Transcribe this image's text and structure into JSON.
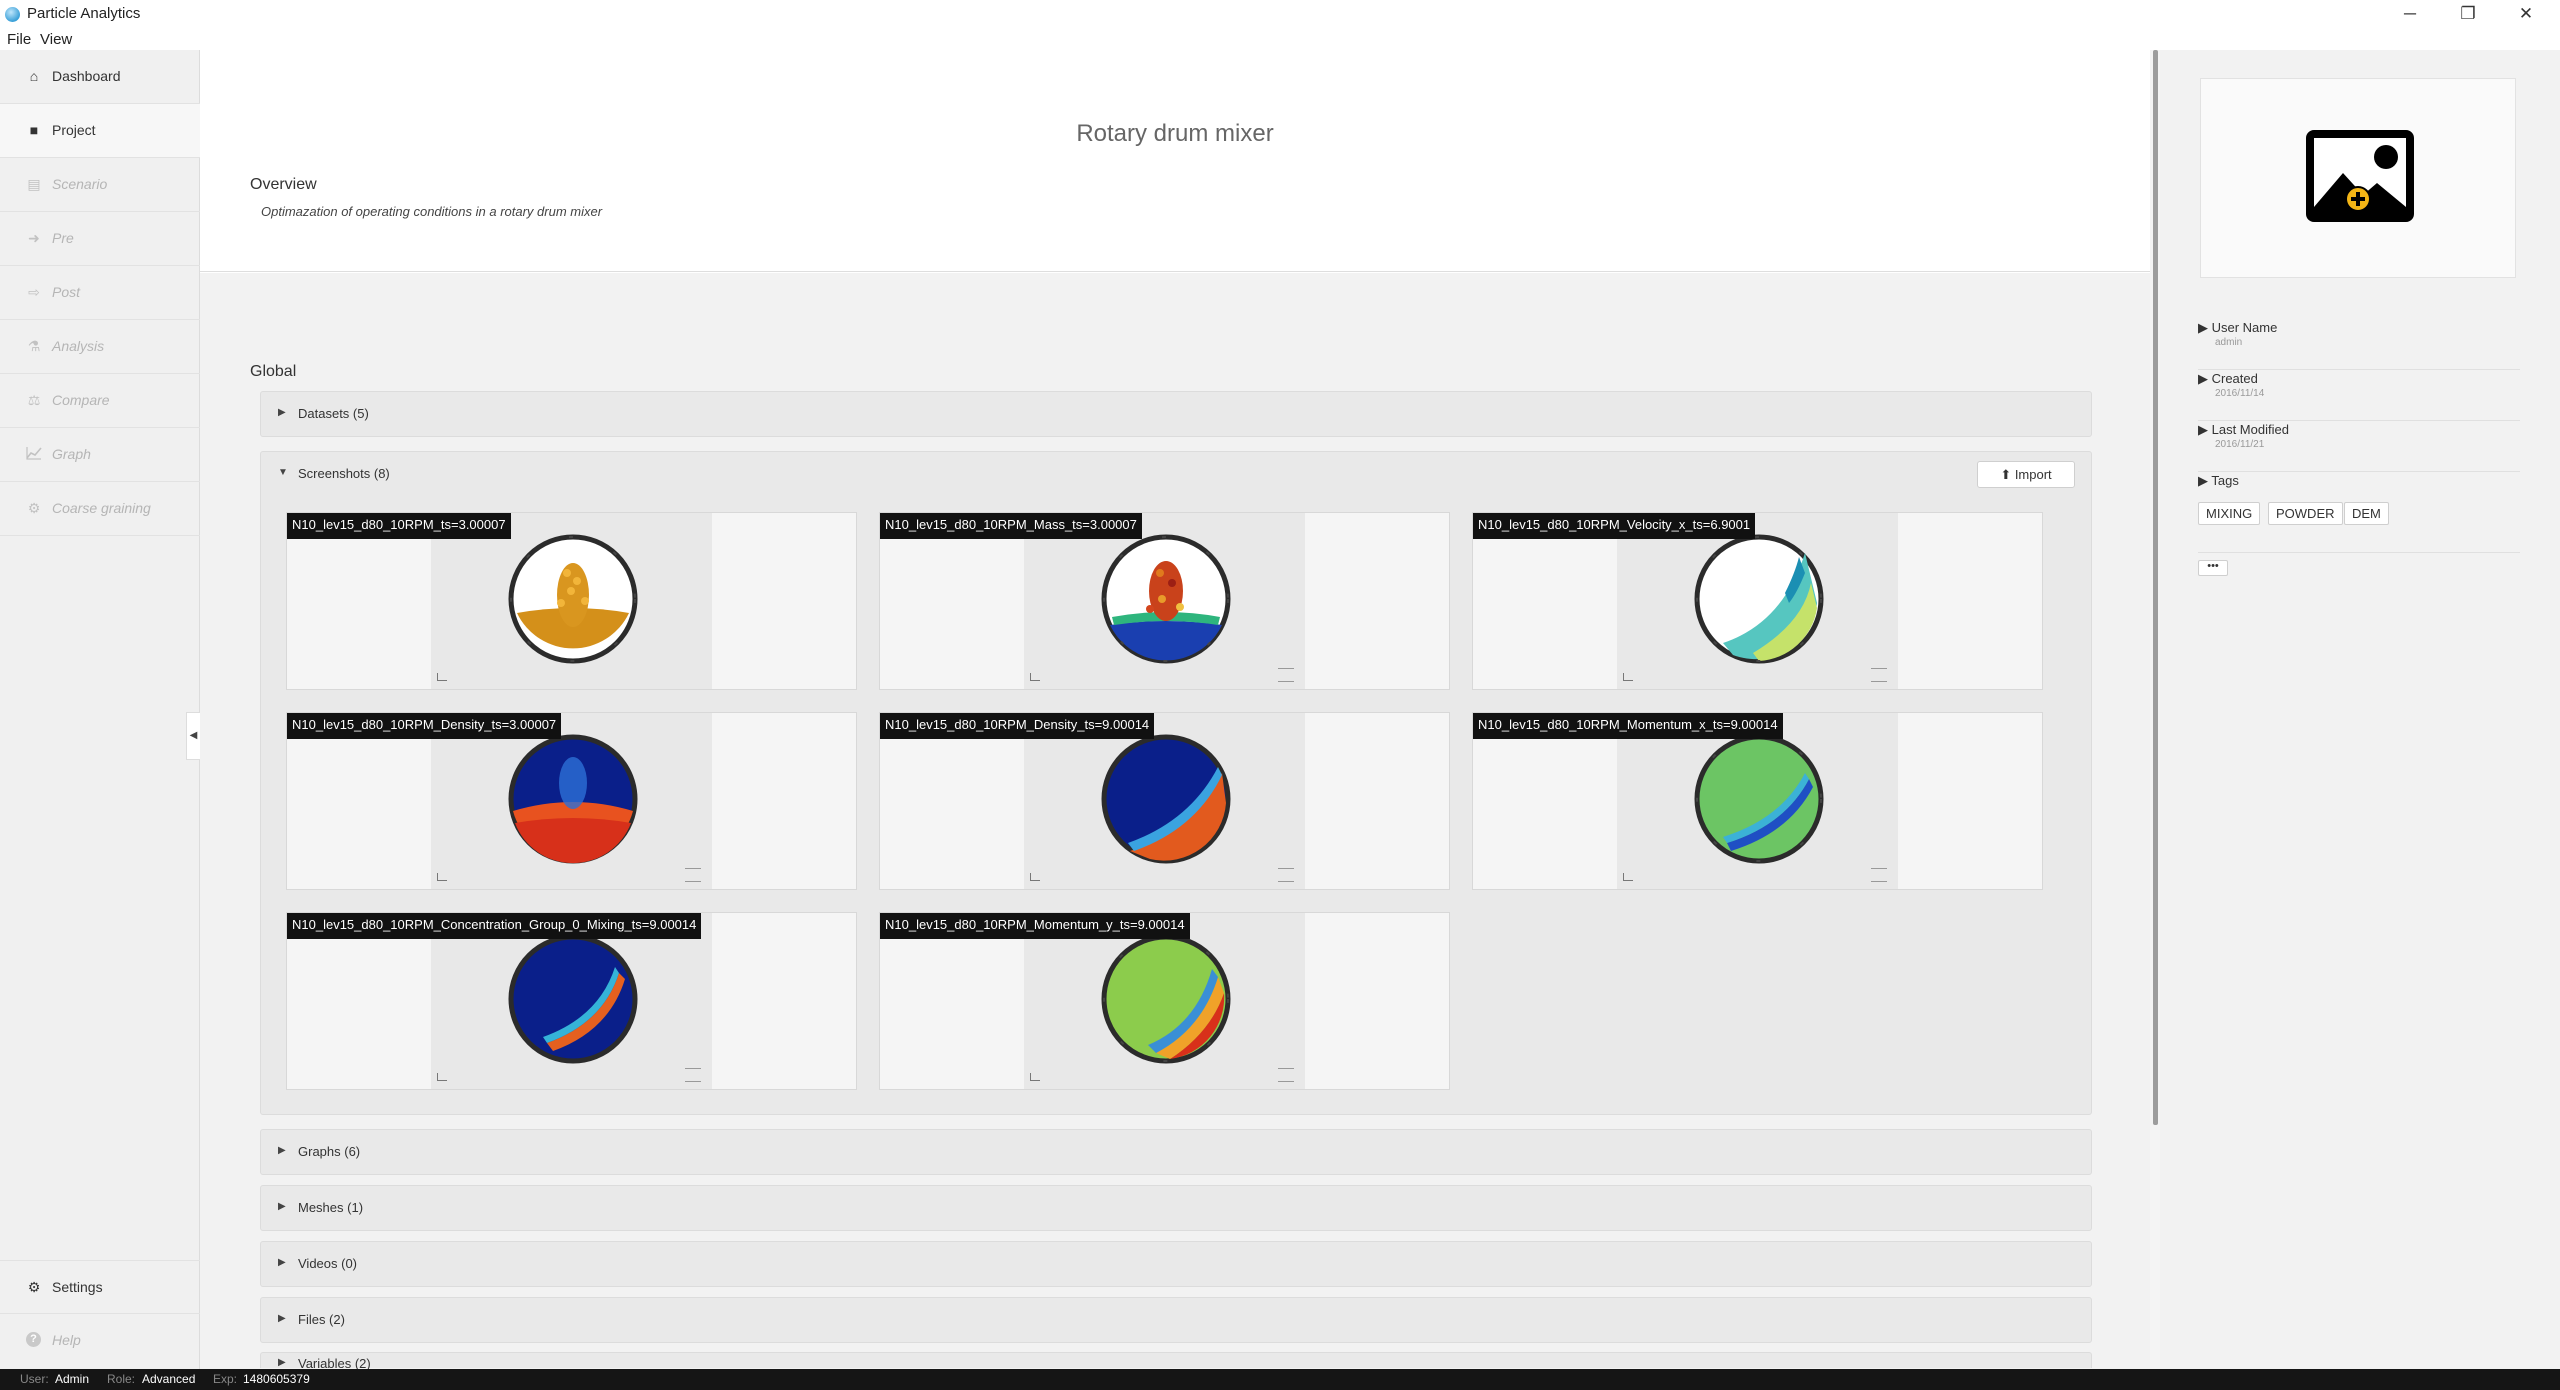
{
  "app": {
    "title": "Particle Analytics"
  },
  "menu": {
    "file": "File",
    "view": "View"
  },
  "window_controls": {
    "minimize": "─",
    "restore": "❐",
    "close": "✕"
  },
  "sidebar": {
    "items": [
      {
        "label": "Dashboard",
        "icon": "home-icon",
        "glyph": "⌂"
      },
      {
        "label": "Project",
        "icon": "folder-icon",
        "glyph": "■"
      },
      {
        "label": "Scenario",
        "icon": "document-icon",
        "glyph": "▤"
      },
      {
        "label": "Pre",
        "icon": "sign-in-icon",
        "glyph": "➜"
      },
      {
        "label": "Post",
        "icon": "sign-out-icon",
        "glyph": "⇨"
      },
      {
        "label": "Analysis",
        "icon": "flask-icon",
        "glyph": "⚗"
      },
      {
        "label": "Compare",
        "icon": "balance-icon",
        "glyph": "⚖"
      },
      {
        "label": "Graph",
        "icon": "line-chart-icon",
        "glyph": "📈"
      },
      {
        "label": "Coarse graining",
        "icon": "gear-icon",
        "glyph": "⚙"
      }
    ],
    "settings": {
      "label": "Settings",
      "icon": "cogs-icon",
      "glyph": "⚙"
    },
    "help": {
      "label": "Help",
      "icon": "help-icon",
      "glyph": "?"
    },
    "collapse_glyph": "◀"
  },
  "main": {
    "title": "Rotary drum mixer",
    "overview_label": "Overview",
    "overview_description": "Optimazation of operating conditions in a rotary drum mixer",
    "global_label": "Global",
    "sections": {
      "datasets": "Datasets (5)",
      "screenshots": "Screenshots (8)",
      "graphs": "Graphs (6)",
      "meshes": "Meshes (1)",
      "videos": "Videos (0)",
      "files": "Files (2)",
      "variables": "Variables (2)"
    },
    "import_label": "⬆ Import",
    "screenshots": [
      "N10_lev15_d80_10RPM_ts=3.00007",
      "N10_lev15_d80_10RPM_Mass_ts=3.00007",
      "N10_lev15_d80_10RPM_Velocity_x_ts=6.9001",
      "N10_lev15_d80_10RPM_Density_ts=3.00007",
      "N10_lev15_d80_10RPM_Density_ts=9.00014",
      "N10_lev15_d80_10RPM_Momentum_x_ts=9.00014",
      "N10_lev15_d80_10RPM_Concentration_Group_0_Mixing_ts=9.00014",
      "N10_lev15_d80_10RPM_Momentum_y_ts=9.00014"
    ]
  },
  "details": {
    "user_name_label": "▶ User Name",
    "user_name": "admin",
    "created_label": "▶ Created",
    "created": "2016/11/14",
    "modified_label": "▶ Last Modified",
    "modified": "2016/11/21",
    "tags_label": "▶ Tags",
    "tags": [
      "MIXING",
      "POWDER",
      "DEM"
    ],
    "more": "•••"
  },
  "status": {
    "user_label": "User:",
    "user": "Admin",
    "role_label": "Role:",
    "role": "Advanced",
    "exp_label": "Exp:",
    "exp": "1480605379"
  },
  "colors": {
    "sidebar_bg": "#f0f0f0",
    "section_bg": "#e9e9e9",
    "status_bg": "#151515",
    "caption_bg": "#111111"
  }
}
